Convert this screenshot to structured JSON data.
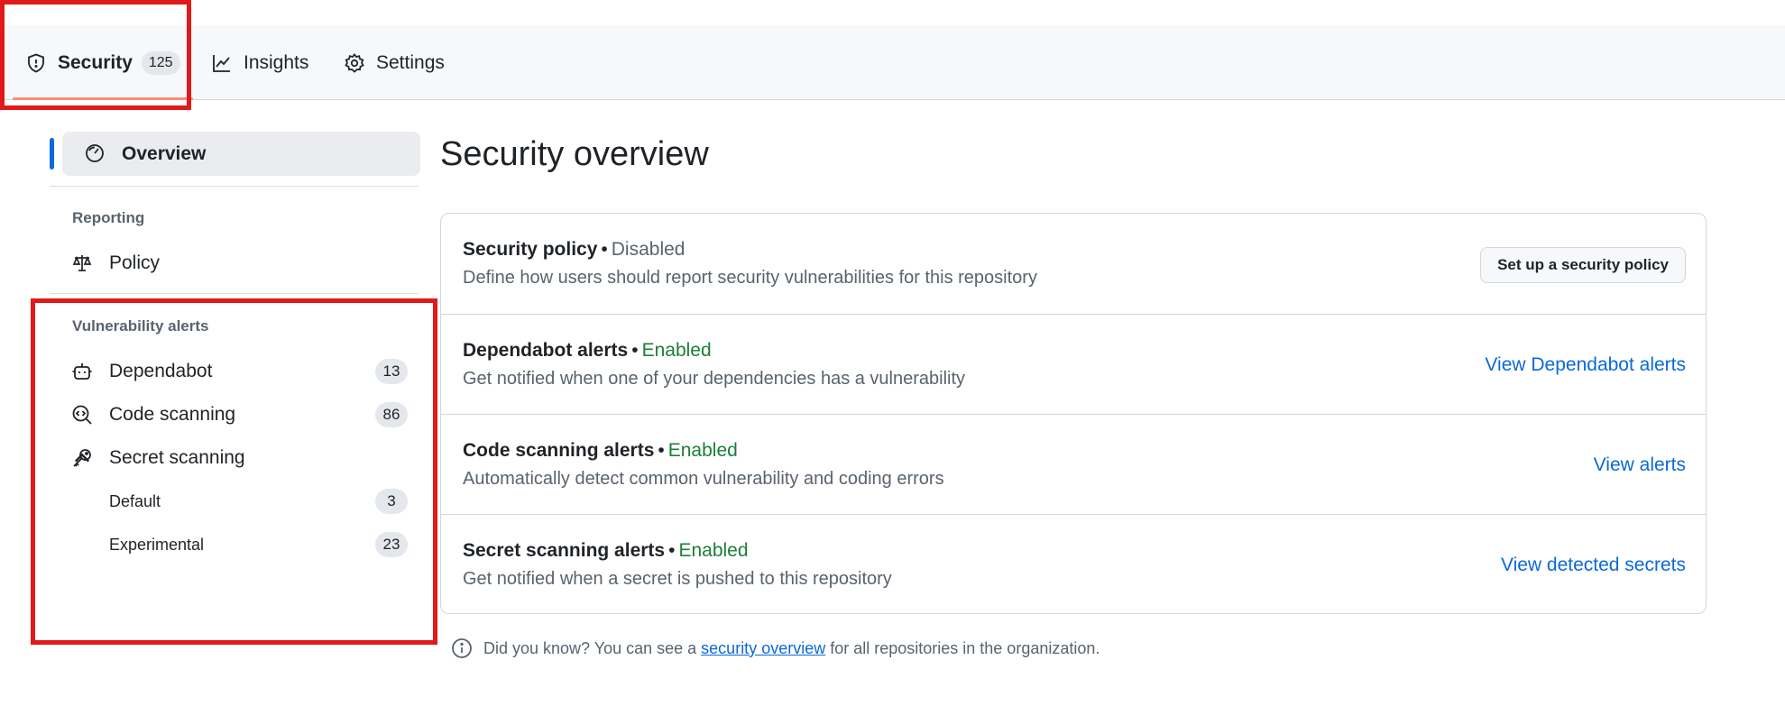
{
  "tabs": {
    "security": {
      "label": "Security",
      "count": "125"
    },
    "insights": {
      "label": "Insights"
    },
    "settings": {
      "label": "Settings"
    }
  },
  "sidebar": {
    "overview": "Overview",
    "reporting_label": "Reporting",
    "policy": "Policy",
    "vuln_label": "Vulnerability alerts",
    "dependabot": {
      "label": "Dependabot",
      "count": "13"
    },
    "code_scanning": {
      "label": "Code scanning",
      "count": "86"
    },
    "secret_scanning": {
      "label": "Secret scanning"
    },
    "default": {
      "label": "Default",
      "count": "3"
    },
    "experimental": {
      "label": "Experimental",
      "count": "23"
    }
  },
  "main": {
    "title": "Security overview",
    "rows": [
      {
        "title": "Security policy",
        "status": "Disabled",
        "desc": "Define how users should report security vulnerabilities for this repository",
        "action": "Set up a security policy"
      },
      {
        "title": "Dependabot alerts",
        "status": "Enabled",
        "desc": "Get notified when one of your dependencies has a vulnerability",
        "action": "View Dependabot alerts"
      },
      {
        "title": "Code scanning alerts",
        "status": "Enabled",
        "desc": "Automatically detect common vulnerability and coding errors",
        "action": "View alerts"
      },
      {
        "title": "Secret scanning alerts",
        "status": "Enabled",
        "desc": "Get notified when a secret is pushed to this repository",
        "action": "View detected secrets"
      }
    ],
    "separator": "•",
    "tip": {
      "before": "Did you know? You can see a",
      "link": "security overview",
      "after": "for all repositories in the organization."
    }
  },
  "colors": {
    "accent": "#0969da",
    "enabled": "#1a7f37",
    "highlight": "#e0191a",
    "tab_underline": "#fd8c73"
  }
}
